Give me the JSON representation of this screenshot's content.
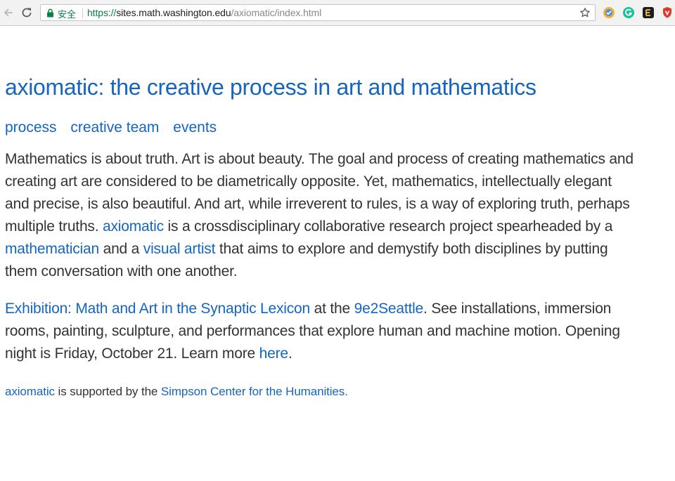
{
  "browser": {
    "secure_label": "安全",
    "url_scheme": "https://",
    "url_host": "sites.math.washington.edu",
    "url_path": "/axiomatic/index.html"
  },
  "page": {
    "title": "axiomatic: the creative process in art and mathematics",
    "nav": [
      "process",
      "creative team",
      "events"
    ],
    "intro": {
      "t1": "Mathematics is about truth. Art is about beauty. The goal and process of creating mathematics and creating art are considered to be diametrically opposite. Yet, mathematics, intellectually elegant and precise, is also beautiful. And art, while irreverent to rules, is a way of exploring truth, perhaps multiple truths. ",
      "link1": "axiomatic",
      "t2": " is a crossdisciplinary collaborative research project spearheaded by a ",
      "link2": "mathematician",
      "t3": " and a ",
      "link3": "visual artist",
      "t4": " that aims to explore and demystify both disciplines by putting them conversation with one another."
    },
    "exhibition": {
      "link1": "Exhibition: Math and Art in the Synaptic Lexicon",
      "t1": " at the ",
      "link2": "9e2Seattle",
      "t2": ". See installations, immersion rooms, painting, sculpture, and performances that explore human and machine motion. Opening night is Friday, October 21. Learn more ",
      "link3": "here",
      "t3": "."
    },
    "support": {
      "link1": "axiomatic",
      "t1": " is supported by the ",
      "link2": "Simpson Center for the Humanities",
      "t2": "."
    }
  },
  "colors": {
    "link": "#1565c0",
    "text": "#333333",
    "secure_green": "#0b8043"
  },
  "icons": [
    "back-arrow-icon",
    "reload-icon",
    "lock-icon",
    "star-icon",
    "ext-icon-1",
    "grammarly-icon",
    "evernote-icon",
    "shield-ext-icon"
  ]
}
